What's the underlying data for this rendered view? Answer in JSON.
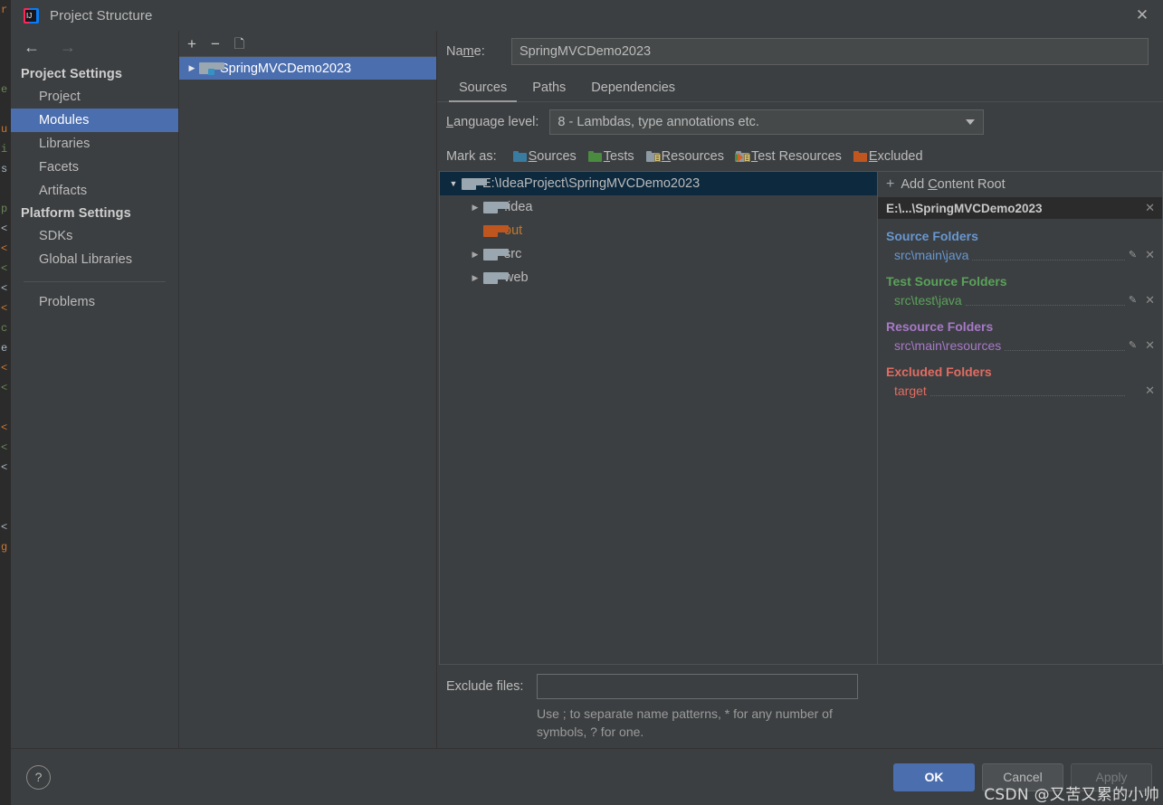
{
  "window": {
    "title": "Project Structure",
    "app_icon": "intellij-idea-icon",
    "close_icon": "close-icon"
  },
  "backdrop": {
    "lines": [
      "r",
      "",
      "",
      "",
      "e",
      "",
      "u",
      "i",
      "s",
      "",
      "p",
      "<",
      "<",
      "<",
      "<",
      "<",
      "c",
      "e",
      "<",
      "<",
      "",
      "<",
      "<",
      "<",
      "",
      "",
      "<",
      "g"
    ]
  },
  "nav": {
    "back_icon": "back-arrow-icon",
    "forward_icon": "forward-arrow-icon",
    "groups": [
      {
        "title": "Project Settings",
        "items": [
          {
            "label": "Project",
            "selected": false
          },
          {
            "label": "Modules",
            "selected": true
          },
          {
            "label": "Libraries",
            "selected": false
          },
          {
            "label": "Facets",
            "selected": false
          },
          {
            "label": "Artifacts",
            "selected": false
          }
        ]
      },
      {
        "title": "Platform Settings",
        "items": [
          {
            "label": "SDKs",
            "selected": false
          },
          {
            "label": "Global Libraries",
            "selected": false
          }
        ]
      }
    ],
    "extra": [
      {
        "label": "Problems",
        "selected": false
      }
    ]
  },
  "modules": {
    "toolbar": {
      "add_icon": "plus-icon",
      "remove_icon": "minus-icon",
      "copy_icon": "copy-icon"
    },
    "rows": [
      {
        "label": "SpringMVCDemo2023",
        "selected": true,
        "expand_icon": "chevron-right-icon",
        "folder": "module-folder-icon"
      }
    ]
  },
  "detail": {
    "name_label": "Name:",
    "name_value": "SpringMVCDemo2023",
    "tabs": [
      {
        "label": "Sources",
        "active": true
      },
      {
        "label": "Paths",
        "active": false
      },
      {
        "label": "Dependencies",
        "active": false
      }
    ],
    "language_level_label": "Language level:",
    "language_level_value": "8 - Lambdas, type annotations etc.",
    "language_level_caret": "chevron-down-icon",
    "mark_as_label": "Mark as:",
    "mark_as": [
      {
        "label": "Sources",
        "color": "#3a7ca0",
        "kind": "blue"
      },
      {
        "label": "Tests",
        "color": "#4a8b3f",
        "kind": "green"
      },
      {
        "label": "Resources",
        "color": "#8d99a3",
        "kind": "gray"
      },
      {
        "label": "Test Resources",
        "color": "#8d99a3",
        "kind": "testres"
      },
      {
        "label": "Excluded",
        "color": "#c0561f",
        "kind": "orange"
      }
    ],
    "tree": [
      {
        "label": "E:\\IdeaProject\\SpringMVCDemo2023",
        "depth": 0,
        "arrow": "down",
        "selected": true,
        "folder": "gray",
        "color": "default"
      },
      {
        "label": ".idea",
        "depth": 1,
        "arrow": "right",
        "selected": false,
        "folder": "gray",
        "color": "default"
      },
      {
        "label": "out",
        "depth": 1,
        "arrow": "none",
        "selected": false,
        "folder": "orange",
        "color": "orange"
      },
      {
        "label": "src",
        "depth": 1,
        "arrow": "right",
        "selected": false,
        "folder": "gray",
        "color": "default"
      },
      {
        "label": "web",
        "depth": 1,
        "arrow": "right",
        "selected": false,
        "folder": "gray",
        "color": "default"
      }
    ],
    "exclude_files_label": "Exclude files:",
    "exclude_files_value": "",
    "exclude_hint": "Use ; to separate name patterns, * for any number of symbols, ? for one."
  },
  "content_root": {
    "add_label": "Add Content Root",
    "add_icon": "plus-icon",
    "root_path": "E:\\...\\SpringMVCDemo2023",
    "root_close_icon": "close-icon",
    "groups": [
      {
        "title": "Source Folders",
        "kind": "src",
        "color": "#6897d0",
        "entries": [
          {
            "path": "src\\main\\java",
            "has_edit": true,
            "edit_icon": "pencil-icon",
            "remove_icon": "close-icon"
          }
        ]
      },
      {
        "title": "Test Source Folders",
        "kind": "test",
        "color": "#5aa25a",
        "entries": [
          {
            "path": "src\\test\\java",
            "has_edit": true,
            "edit_icon": "pencil-icon",
            "remove_icon": "close-icon"
          }
        ]
      },
      {
        "title": "Resource Folders",
        "kind": "res",
        "color": "#a779c8",
        "entries": [
          {
            "path": "src\\main\\resources",
            "has_edit": true,
            "edit_icon": "pencil-icon",
            "remove_icon": "close-icon"
          }
        ]
      },
      {
        "title": "Excluded Folders",
        "kind": "exc",
        "color": "#e06c62",
        "entries": [
          {
            "path": "target",
            "has_edit": false,
            "edit_icon": "",
            "remove_icon": "close-icon"
          }
        ]
      }
    ]
  },
  "footer": {
    "help_label": "?",
    "help_icon": "help-icon",
    "buttons": [
      {
        "label": "OK",
        "style": "primary"
      },
      {
        "label": "Cancel",
        "style": "normal"
      },
      {
        "label": "Apply",
        "style": "disabled"
      }
    ]
  },
  "watermark": "CSDN @又苦又累的小帅",
  "colors": {
    "dialog_bg": "#3c3f41",
    "panel_dark": "#2b2b2b",
    "selection_blue": "#4b6eaf",
    "tree_selection": "#0d293e",
    "text": "#bbbbbb"
  }
}
